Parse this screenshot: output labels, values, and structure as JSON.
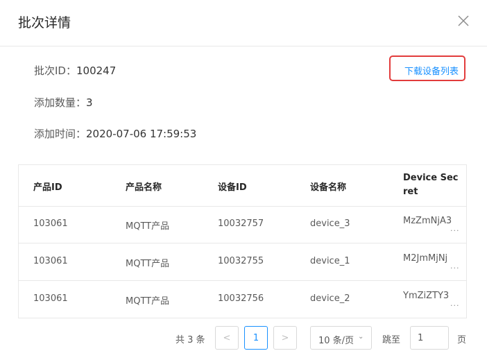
{
  "modal": {
    "title": "批次详情"
  },
  "info": {
    "batch_id_label": "批次ID：",
    "batch_id_value": "100247",
    "count_label": "添加数量：",
    "count_value": "3",
    "time_label": "添加时间：",
    "time_value": "2020-07-06 17:59:53"
  },
  "download_label": "下载设备列表",
  "table": {
    "columns": [
      "产品ID",
      "产品名称",
      "设备ID",
      "设备名称",
      "Device Sec",
      "ret"
    ],
    "rows": [
      {
        "product_id": "103061",
        "product_name": "MQTT产品",
        "device_id": "10032757",
        "device_name": "device_3",
        "secret": "MzZmNjA3"
      },
      {
        "product_id": "103061",
        "product_name": "MQTT产品",
        "device_id": "10032755",
        "device_name": "device_1",
        "secret": "M2JmMjNj"
      },
      {
        "product_id": "103061",
        "product_name": "MQTT产品",
        "device_id": "10032756",
        "device_name": "device_2",
        "secret": "YmZiZTY3"
      }
    ],
    "ellipsis": "..."
  },
  "pagination": {
    "total": "共 3 条",
    "prev": "<",
    "current_page": "1",
    "next": ">",
    "page_size": "10 条/页",
    "jump_label": "跳至",
    "jump_value": "1",
    "page_unit": "页"
  },
  "icons": {
    "close": "close-icon",
    "prev": "chevron-left-icon",
    "next": "chevron-right-icon",
    "dropdown": "chevron-down-icon"
  },
  "colors": {
    "link": "#1890ff",
    "highlight_border": "#e23b3b",
    "border": "#e8e8e8"
  }
}
